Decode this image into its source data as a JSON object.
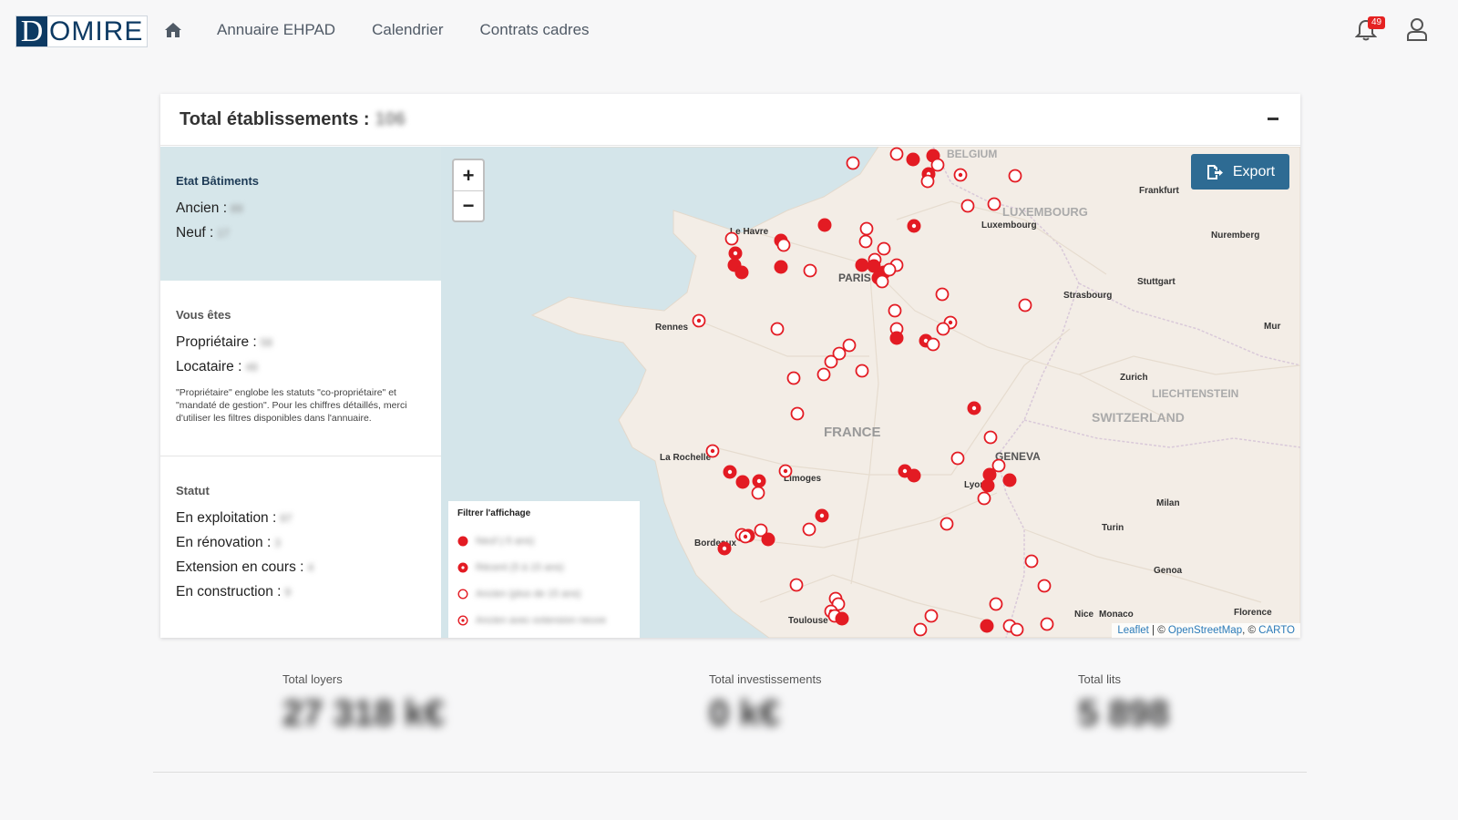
{
  "logo": {
    "first": "D",
    "rest": "OMIRE"
  },
  "nav": {
    "items": [
      "Annuaire EHPAD",
      "Calendrier",
      "Contrats cadres"
    ]
  },
  "notifications": {
    "count": "49"
  },
  "card": {
    "title": "Total établissements :",
    "title_value": "106"
  },
  "etat": {
    "title": "Etat Bâtiments",
    "ancien_label": "Ancien :",
    "ancien_value": "89",
    "neuf_label": "Neuf :",
    "neuf_value": "17"
  },
  "vous": {
    "title": "Vous êtes",
    "prop_label": "Propriétaire :",
    "prop_value": "58",
    "loc_label": "Locataire :",
    "loc_value": "48",
    "note": "\"Propriétaire\" englobe les statuts \"co-propriétaire\" et \"mandaté de gestion\". Pour les chiffres détaillés, merci d'utiliser les filtres disponibles dans l'annuaire."
  },
  "statut": {
    "title": "Statut",
    "items": [
      {
        "label": "En exploitation :",
        "value": "97"
      },
      {
        "label": "En rénovation :",
        "value": "3"
      },
      {
        "label": "Extension en cours :",
        "value": "4"
      },
      {
        "label": "En construction :",
        "value": "9"
      }
    ]
  },
  "map": {
    "zoom_in": "+",
    "zoom_out": "−",
    "export_label": "Export",
    "cities": [
      {
        "name": "Le Havre"
      },
      {
        "name": "PARIS"
      },
      {
        "name": "Rennes"
      },
      {
        "name": "La Rochelle"
      },
      {
        "name": "Limoges"
      },
      {
        "name": "Bordeaux"
      },
      {
        "name": "Toulouse"
      },
      {
        "name": "FRANCE"
      },
      {
        "name": "Lyon"
      },
      {
        "name": "GENEVA"
      },
      {
        "name": "SWITZERLAND"
      },
      {
        "name": "LIECHTENSTEIN"
      },
      {
        "name": "Zurich"
      },
      {
        "name": "Strasbourg"
      },
      {
        "name": "Stuttgart"
      },
      {
        "name": "Frankfurt"
      },
      {
        "name": "Nuremberg"
      },
      {
        "name": "LUXEMBOURG"
      },
      {
        "name": "Luxembourg"
      },
      {
        "name": "Milan"
      },
      {
        "name": "Turin"
      },
      {
        "name": "Genoa"
      },
      {
        "name": "Nice"
      },
      {
        "name": "Monaco"
      },
      {
        "name": "Florence"
      },
      {
        "name": "Mur"
      },
      {
        "name": "BELGIUM"
      }
    ],
    "filter": {
      "title": "Filtrer l'affichage",
      "items": [
        "Neuf (-5 ans)",
        "Récent (5 à 15 ans)",
        "Ancien (plus de 15 ans)",
        "Ancien avec extension neuve"
      ]
    },
    "attribution": {
      "leaflet": "Leaflet",
      "sep1": " | © ",
      "osm": "OpenStreetMap",
      "sep2": ", © ",
      "carto": "CARTO"
    },
    "colors": {
      "marker": "#e31b23",
      "sea": "#d4e5ea",
      "land": "#f3ede6"
    }
  },
  "totals": [
    {
      "label": "Total loyers",
      "value": "27 318 k€"
    },
    {
      "label": "Total investissements",
      "value": "0 k€"
    },
    {
      "label": "Total lits",
      "value": "5 898"
    }
  ]
}
